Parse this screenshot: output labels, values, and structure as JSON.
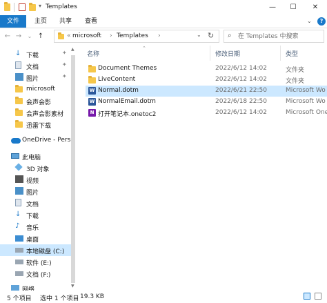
{
  "window": {
    "title": "Templates"
  },
  "ribbon": {
    "tabs": [
      "文件",
      "主页",
      "共享",
      "查看"
    ]
  },
  "address": {
    "prefix": "«",
    "crumbs": [
      "microsoft",
      "Templates"
    ],
    "separator": "›"
  },
  "search": {
    "placeholder": "在 Templates 中搜索"
  },
  "nav": {
    "items": [
      {
        "label": "下载",
        "pinned": true
      },
      {
        "label": "文档",
        "pinned": true
      },
      {
        "label": "图片",
        "pinned": true
      },
      {
        "label": "microsoft",
        "pinned": false
      },
      {
        "label": "会声会影",
        "pinned": false
      },
      {
        "label": "会声会影素材",
        "pinned": false
      },
      {
        "label": "迅雷下载",
        "pinned": false
      },
      {
        "label": "OneDrive - Perso",
        "pinned": false
      },
      {
        "label": "此电脑",
        "pinned": false
      },
      {
        "label": "3D 对象",
        "pinned": false
      },
      {
        "label": "视频",
        "pinned": false
      },
      {
        "label": "图片",
        "pinned": false
      },
      {
        "label": "文档",
        "pinned": false
      },
      {
        "label": "下载",
        "pinned": false
      },
      {
        "label": "音乐",
        "pinned": false
      },
      {
        "label": "桌面",
        "pinned": false
      },
      {
        "label": "本地磁盘 (C:)",
        "pinned": false
      },
      {
        "label": "软件 (E:)",
        "pinned": false
      },
      {
        "label": "文档 (F:)",
        "pinned": false
      },
      {
        "label": "网络",
        "pinned": false
      }
    ]
  },
  "columns": {
    "name": "名称",
    "modified": "修改日期",
    "type": "类型"
  },
  "files": [
    {
      "name": "Document Themes",
      "modified": "2022/6/12 14:02",
      "type": "文件夹",
      "icon": "folder-icon"
    },
    {
      "name": "LiveContent",
      "modified": "2022/6/12 14:02",
      "type": "文件夹",
      "icon": "folder-icon"
    },
    {
      "name": "Normal.dotm",
      "modified": "2022/6/21 22:50",
      "type": "Microsoft Wo",
      "icon": "word-template-icon"
    },
    {
      "name": "NormalEmail.dotm",
      "modified": "2022/6/18 22:50",
      "type": "Microsoft Wo",
      "icon": "word-template-icon"
    },
    {
      "name": "打开笔记本.onetoc2",
      "modified": "2022/6/12 14:02",
      "type": "Microsoft One",
      "icon": "onenote-icon"
    }
  ],
  "status": {
    "count": "5 个项目",
    "selected": "选中 1 个项目",
    "size": "19.3 KB"
  },
  "colors": {
    "accent": "#1979ca",
    "selection": "#cce8ff",
    "folder": "#f6c74a"
  }
}
